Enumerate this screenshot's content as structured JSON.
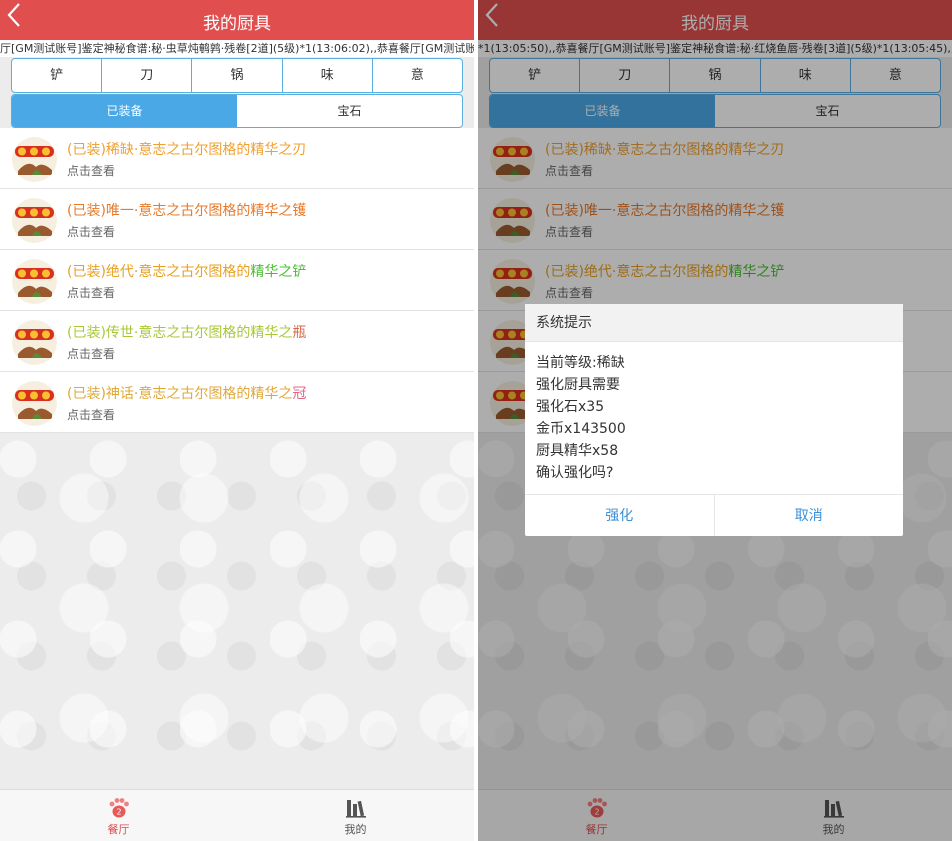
{
  "screen_left": {
    "header_title": "我的厨具",
    "ticker": "厅[GM测试账号]鉴定神秘食谱:秘·虫草炖鹌鹑·残卷[2道](5级)*1(13:06:02),,恭喜餐厅[GM测试账号]"
  },
  "screen_right": {
    "header_title": "我的厨具",
    "ticker": "*1(13:05:50),,恭喜餐厅[GM测试账号]鉴定神秘食谱:秘·红烧鱼唇·残卷[3道](5级)*1(13:05:45),,恭喜"
  },
  "tools": [
    "铲",
    "刀",
    "锅",
    "味",
    "意"
  ],
  "segments": [
    "已装备",
    "宝石"
  ],
  "items": [
    {
      "prefix": "(已装)稀缺·意志之古尔图格的精华之刃",
      "suffix": "",
      "sub": "点击查看"
    },
    {
      "prefix": "(已装)唯一·意志之古尔图格的精华之镬",
      "suffix": "",
      "sub": "点击查看"
    },
    {
      "prefix": "(已装)绝代·意志之古尔图格的",
      "suffix": "精华之铲",
      "sub": "点击查看"
    },
    {
      "prefix": "(已装)传世·意志之古尔图格的精华之",
      "suffix": "瓶",
      "sub": "点击查看"
    },
    {
      "prefix": "(已装)神话·意志之古尔图格的精华之",
      "suffix": "冠",
      "sub": "点击查看"
    }
  ],
  "tabbar": {
    "restaurant": "餐厅",
    "mine": "我的"
  },
  "dialog": {
    "title": "系统提示",
    "lines": [
      "当前等级:稀缺",
      "强化厨具需要",
      "强化石x35",
      "金币x143500",
      "厨具精华x58",
      "确认强化吗?"
    ],
    "confirm": "强化",
    "cancel": "取消"
  },
  "colors": {
    "header_red": "#e04e4e",
    "accent_blue": "#4aa8e6",
    "dialog_button": "#3a8fd8"
  }
}
